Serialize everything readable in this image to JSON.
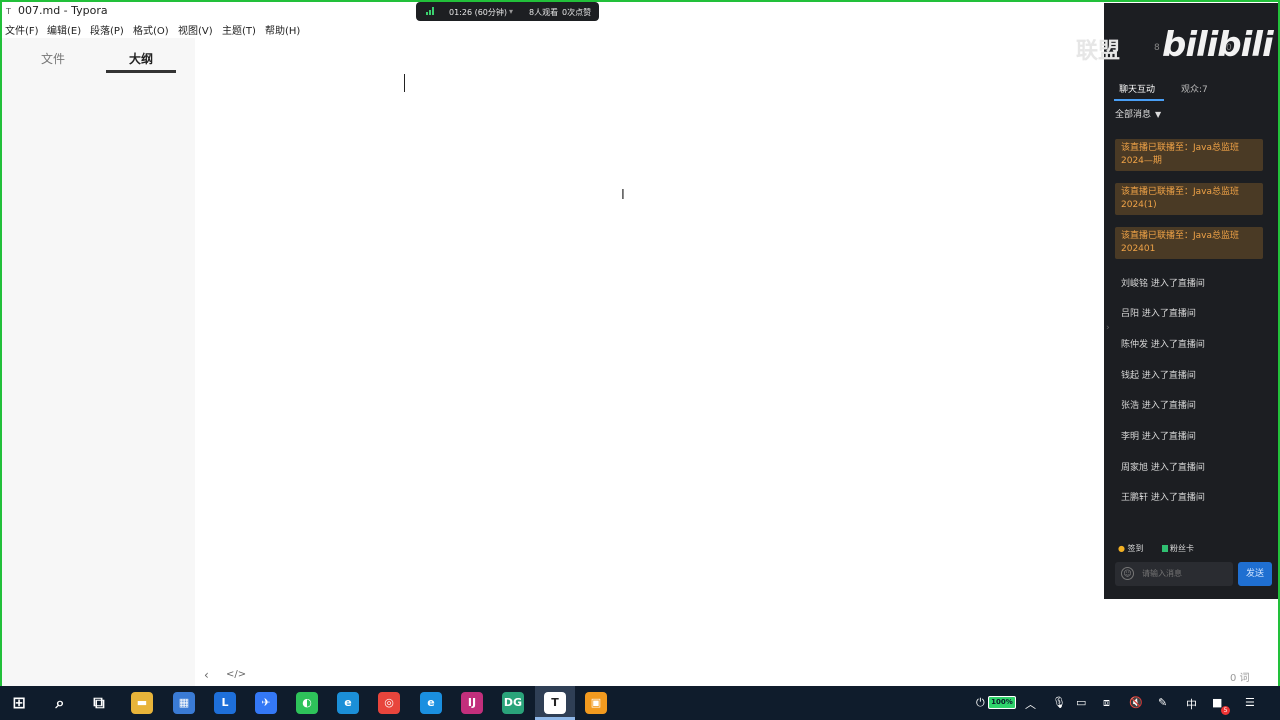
{
  "window": {
    "title": "007.md - Typora",
    "app_icon": "T"
  },
  "menu": [
    "文件(F)",
    "编辑(E)",
    "段落(P)",
    "格式(O)",
    "视图(V)",
    "主题(T)",
    "帮助(H)"
  ],
  "sidebar": {
    "tabs": [
      {
        "label": "文件",
        "active": false
      },
      {
        "label": "大纲",
        "active": true
      }
    ]
  },
  "footer": {
    "prev_icon": "‹",
    "source_icon": "</>",
    "word_count": "0 词"
  },
  "live_status": {
    "duration": "01:26 (60分钟)",
    "viewers": "8人观看",
    "likes": "0次点赞",
    "signal_color": "#3bd16f"
  },
  "panel": {
    "watermark_union": "联盟",
    "watermark_logo": "bilibili",
    "stat1": "8",
    "stat2": "0",
    "tabs": [
      "聊天互动",
      "观众:7"
    ],
    "filter": "全部消息",
    "notices": [
      "该直播已联播至：Java总监班2024—期",
      "该直播已联播至：Java总监班2024(1)",
      "该直播已联播至：Java总监班202401"
    ],
    "joins": [
      "刘峻铭 进入了直播间",
      "吕阳 进入了直播间",
      "陈仲发 进入了直播间",
      "钱起 进入了直播间",
      "张浩 进入了直播间",
      "李明 进入了直播间",
      "周家旭 进入了直播间",
      "王鹏轩 进入了直播间"
    ],
    "checkin": "签到",
    "fancard": "粉丝卡",
    "input_placeholder": "请输入消息",
    "send": "发送",
    "accent": "#1f6fd1",
    "notice_color": "#f0a347"
  },
  "taskbar": {
    "apps": [
      {
        "name": "windows-start-icon",
        "glyph": "⊞",
        "color": "transparent"
      },
      {
        "name": "search-icon",
        "glyph": "⌕",
        "color": "transparent"
      },
      {
        "name": "task-view-icon",
        "glyph": "⧉",
        "color": "transparent"
      },
      {
        "name": "file-explorer-icon",
        "glyph": "▬",
        "color": "#e8b43a"
      },
      {
        "name": "store-icon",
        "glyph": "▦",
        "color": "#3a7bd5"
      },
      {
        "name": "app-l-icon",
        "glyph": "L",
        "color": "#1e6fd9"
      },
      {
        "name": "feishu-icon",
        "glyph": "✈",
        "color": "#3478f6"
      },
      {
        "name": "wechat-icon",
        "glyph": "◐",
        "color": "#2ec35a"
      },
      {
        "name": "edge-icon",
        "glyph": "e",
        "color": "#1b8fd8"
      },
      {
        "name": "chrome-icon",
        "glyph": "◎",
        "color": "#e8453c"
      },
      {
        "name": "ie-icon",
        "glyph": "e",
        "color": "#1a8fe0"
      },
      {
        "name": "intellij-icon",
        "glyph": "IJ",
        "color": "#c22f7c"
      },
      {
        "name": "datagrip-icon",
        "glyph": "DG",
        "color": "#2aa37a"
      },
      {
        "name": "typora-icon",
        "glyph": "T",
        "color": "#ffffff"
      },
      {
        "name": "orange-app-icon",
        "glyph": "▣",
        "color": "#f29a1f"
      }
    ],
    "battery": "100%",
    "ime": "中",
    "notification_count": "5"
  }
}
